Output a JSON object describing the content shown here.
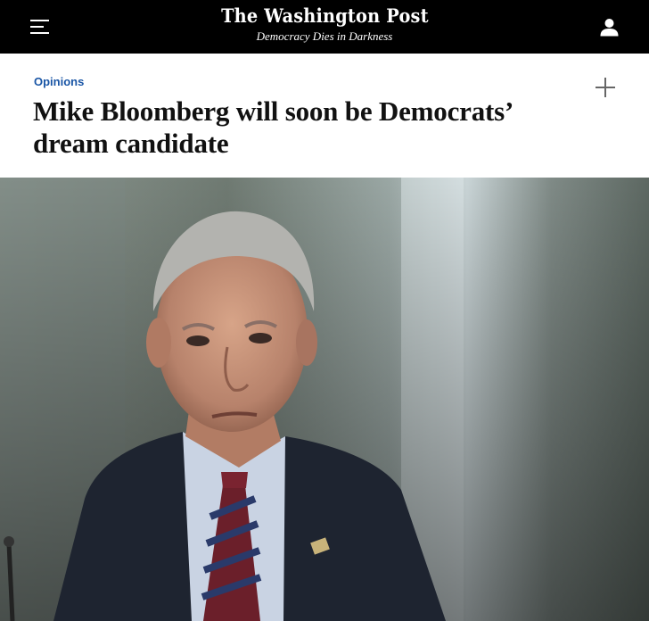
{
  "nav": {
    "menu_icon": "hamburger-menu-icon",
    "logo_text": "The Washington Post",
    "tagline": "Democracy Dies in Darkness",
    "account_icon": "user-icon"
  },
  "article": {
    "section": "Opinions",
    "headline": "Mike Bloomberg will soon be Democrats’ dream candidate",
    "add_icon": "plus-icon"
  },
  "colors": {
    "topbar_bg": "#000000",
    "section_link": "#1955a5",
    "headline_text": "#111111"
  }
}
